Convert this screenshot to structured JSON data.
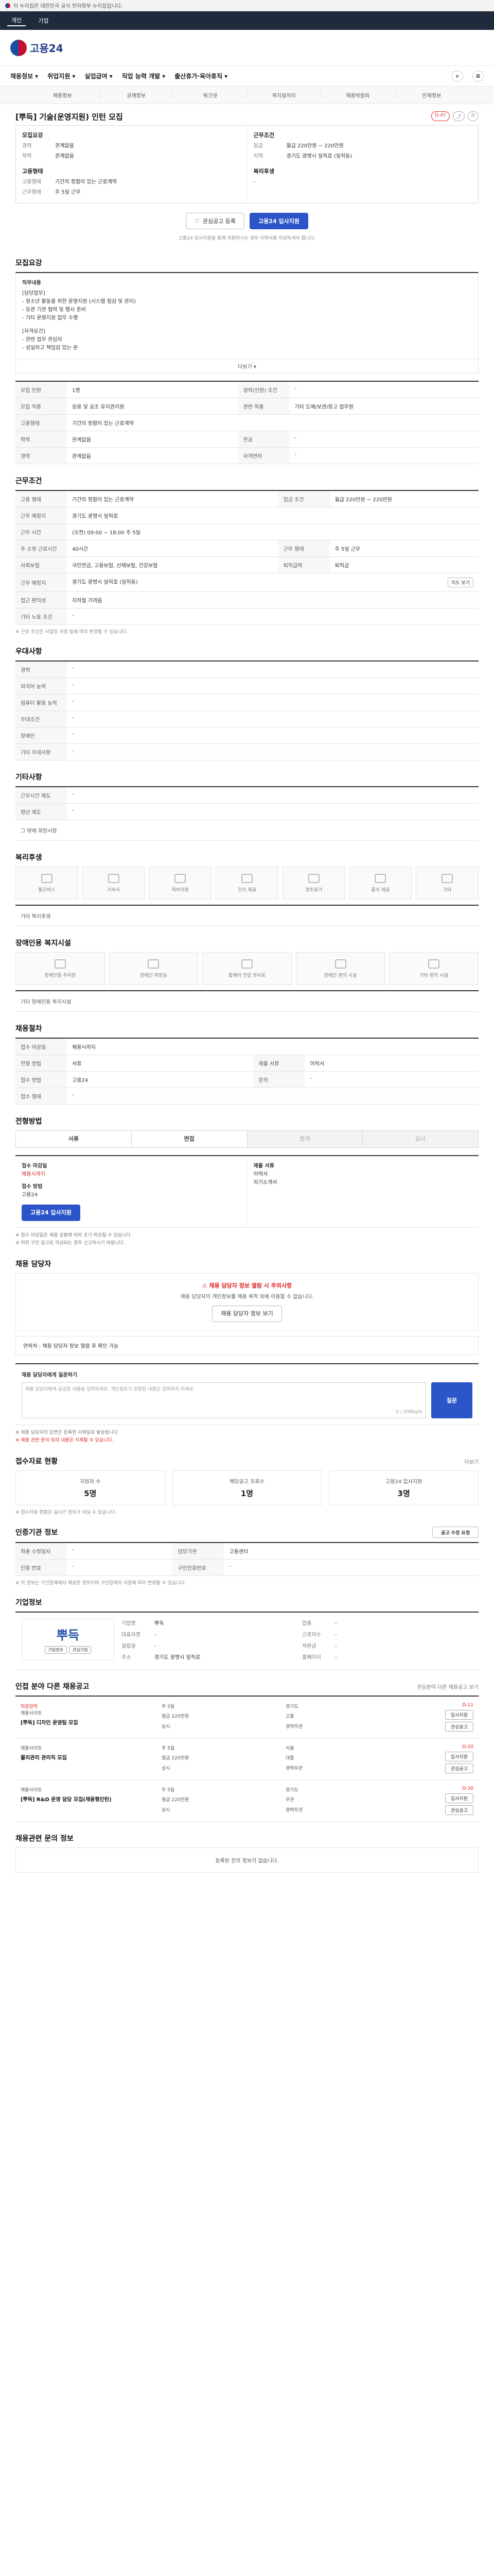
{
  "gov_banner": {
    "text": "이 누리집은 대한민국 공식 전자정부 누리집입니다."
  },
  "topbar": {
    "items": [
      "개인",
      "기업"
    ]
  },
  "brand": {
    "logo_text": "고용24"
  },
  "gnb": {
    "items": [
      "채용정보",
      "취업지원",
      "실업급여",
      "직업 능력 개발",
      "출산휴가·육아휴직"
    ]
  },
  "subtabs": [
    "채용정보",
    "공채정보",
    "워크넷",
    "복지일자리",
    "채용박람회",
    "인재정보"
  ],
  "job": {
    "title": "[뿌득] 기술(운영지원) 인턴 모집",
    "badge": "D-47",
    "company_label": "모집요강",
    "company_name": "뿌득",
    "summary_left": [
      {
        "k": "경력",
        "v": "관계없음"
      },
      {
        "k": "학력",
        "v": "관계없음"
      }
    ],
    "summary_right_title": "근무조건",
    "summary_right": [
      {
        "k": "임금",
        "v": "월급 220만원 ~ 220만원"
      },
      {
        "k": "지역",
        "v": "경기도 광명시 일직로 (일직동)"
      }
    ],
    "summary_left2_title": "고용형태",
    "summary_left2": [
      {
        "k": "고용형태",
        "v": "기간의 정함이 있는 근로계약"
      },
      {
        "k": "근무형태",
        "v": "주 5일 근무"
      }
    ],
    "summary_right2_title": "복리후생",
    "summary_right2": [
      {
        "k": "",
        "v": "-"
      }
    ]
  },
  "apply": {
    "scrap": "관심공고 등록",
    "apply": "고용24 입사지원",
    "note": "고용24 입사지원을 통해 지원하시는 경우 이력서를 작성하셔야 합니다."
  },
  "sections": {
    "recruit": "모집요강",
    "conditions": "근무조건",
    "prefer": "우대사항",
    "etc": "기타사항",
    "welfare": "복리후생",
    "disabled": "장애인용 복지시설",
    "process": "채용절차",
    "method": "전형방법",
    "manager": "채용 담당자",
    "status": "접수자료 현황",
    "info": "인증기관 정보",
    "company": "기업정보",
    "related": "인접 분야 다른 채용공고",
    "inquiries": "채용관련 문의 정보"
  },
  "recruit": {
    "desc_title": "직무내용",
    "desc_lines": [
      "[담당업무]",
      "- 청소년 활동을 위한 운영지원 (시스템 점검 및 관리)",
      "- 유관 기관 협력 및 행사 준비",
      "- 기타 운영지원 업무 수행",
      "[자격요건]",
      "- 관련 업무 관심자",
      "- 성실하고 책임감 있는 분"
    ],
    "more": "더보기",
    "rows": [
      {
        "k": "모집 인원",
        "v": "1명",
        "k2": "경력(인원) 조건",
        "v2": "-"
      },
      {
        "k": "모집 직종",
        "v": "응용 및 공조 유지관리원",
        "k2": "관련 직종",
        "v2": "기타 도매/보관/창고 업무원"
      },
      {
        "k": "고용형태",
        "v": "기간의 정함이 있는 근로계약",
        "k2": "",
        "v2": ""
      },
      {
        "k": "학력",
        "v": "관계없음",
        "k2": "전공",
        "v2": "-"
      },
      {
        "k": "경력",
        "v": "관계없음",
        "k2": "자격면허",
        "v2": "-"
      }
    ]
  },
  "conditions": {
    "rows": [
      {
        "k": "고용 형태",
        "v": "기간의 정함이 있는 근로계약",
        "k2": "임금 조건",
        "v2": "월급 220만원 ~ 220만원"
      },
      {
        "k": "근무 예정지",
        "v": "경기도 광명시 일직로",
        "k2": "",
        "v2": ""
      },
      {
        "k": "근무 시간",
        "v": "(오전) 09:00 ~ 18:00 주 5일",
        "k2": "",
        "v2": ""
      },
      {
        "k": "주 소정 근로시간",
        "v": "40시간",
        "k2": "근무 형태",
        "v2": "주 5일 근무"
      },
      {
        "k": "사회보험",
        "v": "국민연금, 고용보험, 산재보험, 건강보험",
        "k2": "퇴직급여",
        "v2": "퇴직금"
      },
      {
        "k": "근무 예정지",
        "v": "경기도 광명시 일직로 (일직동)",
        "k2": "",
        "v2": ""
      },
      {
        "k": "접근 편의성",
        "v": "지하철 가까움",
        "k2": "",
        "v2": ""
      },
      {
        "k": "기타 노동 조건",
        "v": "-",
        "k2": "",
        "v2": ""
      }
    ],
    "map_btn": "지도 보기",
    "note": "※ 근로 조건은 사업장 사정 등에 따라 변경될 수 있습니다."
  },
  "prefer": {
    "rows": [
      {
        "k": "경력",
        "v": "-"
      },
      {
        "k": "외국어 능력",
        "v": "-"
      },
      {
        "k": "컴퓨터 활용 능력",
        "v": "-"
      },
      {
        "k": "우대조건",
        "v": "-"
      },
      {
        "k": "장애인",
        "v": "-"
      },
      {
        "k": "기타 우대사항",
        "v": "-"
      }
    ]
  },
  "etc": {
    "rows": [
      {
        "k": "근무시간 제도",
        "v": "-"
      },
      {
        "k": "정년 제도",
        "v": "-"
      }
    ],
    "text": "그 밖에 희망사항"
  },
  "welfare": {
    "items": [
      "통근버스",
      "기숙사",
      "학비지원",
      "간식 제공",
      "경조휴가",
      "중식 제공",
      "기타"
    ],
    "text": "기타 복리후생"
  },
  "disabled": {
    "items": [
      "장애인용 주차장",
      "장애인 화장실",
      "휠체어 진입 경사로",
      "장애인 편의 시설",
      "기타 편의 시설"
    ],
    "text": "기타 장애인용 복지시설"
  },
  "process": {
    "rows": [
      {
        "k": "접수 마감일",
        "v": "채용시까지",
        "k2": "",
        "v2": ""
      },
      {
        "k": "전형 방법",
        "v": "서류",
        "k2": "제출 서류",
        "v2": "이력서"
      },
      {
        "k": "접수 방법",
        "v": "고용24",
        "k2": "문의",
        "v2": "-"
      },
      {
        "k": "접수 형태",
        "v": "-",
        "k2": "",
        "v2": ""
      }
    ]
  },
  "method": {
    "tabs": [
      "서류",
      "면접",
      "합격",
      "입사"
    ],
    "apply_deadline_title": "접수 마감일",
    "apply_deadline_value": "채용시까지",
    "apply_method_title": "접수 방법",
    "apply_method_value": "고용24",
    "apply_btn": "고용24 입사지원",
    "submit_title": "제출 서류",
    "submit_lines": [
      "이력서",
      "자기소개서"
    ],
    "notice": [
      "※ 접수 마감일은 채용 상황에 따라 조기 마감될 수 있습니다.",
      "※ 허위 구인 광고로 의심되는 경우 신고하시기 바랍니다."
    ]
  },
  "manager": {
    "warn_title": "채용 담당자 정보 열람 시 주의사항",
    "warn_text": "채용 담당자의 개인정보를 채용 목적 외에 이용할 수 없습니다.",
    "warn_btn": "채용 담당자 정보 보기",
    "contact": "연락처 : 채용 담당자 정보 열람 후 확인 가능",
    "inquiry_title": "채용 담당자에게 질문하기",
    "inquiry_placeholder": "채용 담당자에게 궁금한 내용을 입력하세요. 개인정보가 포함된 내용은 입력하지 마세요.",
    "inquiry_count": "0 / 500byte",
    "inquiry_btn": "질문",
    "notes": [
      "※ 채용 담당자의 답변은 등록한 이메일로 발송됩니다.",
      "※ 채용 관련 문의 외의 내용은 삭제될 수 있습니다."
    ]
  },
  "status": {
    "more": "더보기",
    "cards": [
      {
        "label": "지원자 수",
        "num": "5명"
      },
      {
        "label": "해당공고 조회수",
        "num": "1명"
      },
      {
        "label": "고용24 입사지원",
        "num": "3명"
      }
    ],
    "note": "※ 접수자료 현황은 실시간 정보가 아닐 수 있습니다."
  },
  "info": {
    "rows": [
      {
        "k": "최종 수정일자",
        "v": "-",
        "k2": "담당기관",
        "v2": "고용센터"
      },
      {
        "k": "인증 번호",
        "v": "-",
        "k2": "구인인증번호",
        "v2": "-"
      }
    ],
    "btn": "공고 수정 요청",
    "note": "※ 위 정보는 구인업체에서 제공한 정보이며 구인업체의 사정에 따라 변경될 수 있습니다."
  },
  "company": {
    "logo": "뿌득",
    "btn1": "기업정보",
    "btn2": "관심기업",
    "rows": [
      {
        "k": "기업명",
        "v": "뿌득"
      },
      {
        "k": "업종",
        "v": "-"
      },
      {
        "k": "대표자명",
        "v": "-"
      },
      {
        "k": "근로자수",
        "v": "-"
      },
      {
        "k": "설립일",
        "v": "-"
      },
      {
        "k": "자본금",
        "v": "-"
      },
      {
        "k": "주소",
        "v": "경기도 광명시 일직로"
      },
      {
        "k": "홈페이지",
        "v": "-"
      }
    ]
  },
  "related": {
    "more": "관심분야 다른 채용공고 보기",
    "items": [
      {
        "company": "채용사이트",
        "title": "[뿌득] 디자인 운영팀 모집",
        "tag": "마감임박",
        "meta": [
          "주 5일",
          "경기도",
          "월급 220만원",
          "고졸",
          "상시",
          "경력무관"
        ],
        "date": "D-11"
      },
      {
        "company": "채용사이트",
        "title": "물리관리 관리직 모집",
        "tag": "",
        "meta": [
          "주 5일",
          "서울",
          "월급 220만원",
          "대졸",
          "상시",
          "경력무관"
        ],
        "date": "D-20"
      },
      {
        "company": "채용사이트",
        "title": "[뿌득] R&D 운영 담당 모집(채용형인턴)",
        "tag": "",
        "meta": [
          "주 5일",
          "경기도",
          "월급 220만원",
          "무관",
          "상시",
          "경력무관"
        ],
        "date": "D-30"
      }
    ],
    "apply": "입사지원",
    "scrap": "관심공고"
  },
  "inquiries": {
    "empty": "등록된 문의 정보가 없습니다."
  }
}
